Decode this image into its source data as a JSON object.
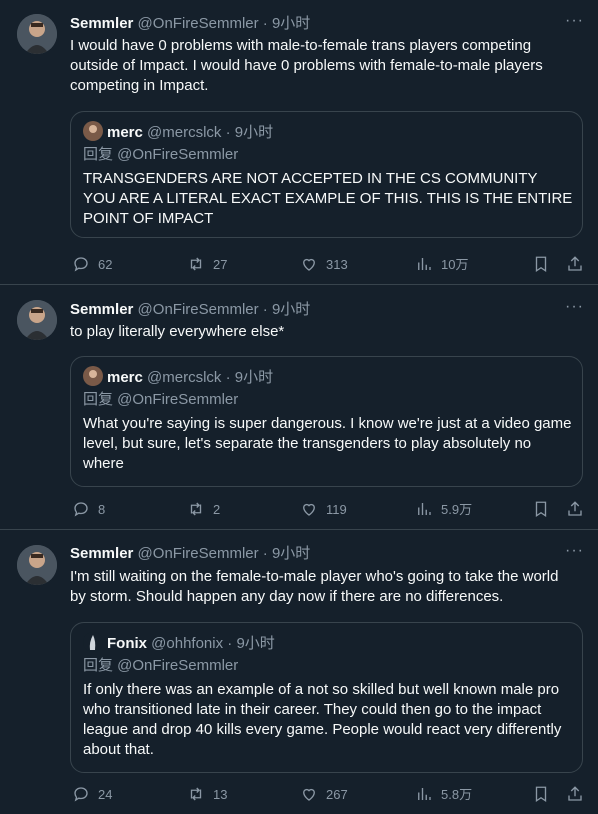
{
  "tweets": [
    {
      "name": "Semmler",
      "handle": "@OnFireSemmler",
      "time": "· 9小时",
      "more": "···",
      "text": "I would have 0 problems with male-to-female trans players competing outside of Impact. I would have 0 problems with female-to-male players competing in Impact.",
      "quote": {
        "name": "merc",
        "handle": "@mercslck",
        "time": "· 9小时",
        "reply": "回复 @OnFireSemmler",
        "text": "TRANSGENDERS ARE NOT ACCEPTED IN THE CS COMMUNITY YOU ARE A LITERAL EXACT EXAMPLE OF THIS. THIS IS THE ENTIRE POINT OF IMPACT"
      },
      "stats": {
        "replies": "62",
        "retweets": "27",
        "likes": "313",
        "views": "10万"
      }
    },
    {
      "name": "Semmler",
      "handle": "@OnFireSemmler",
      "time": "· 9小时",
      "more": "···",
      "text": "to play literally everywhere else*",
      "quote": {
        "name": "merc",
        "handle": "@mercslck",
        "time": "· 9小时",
        "reply": "回复 @OnFireSemmler",
        "text": "What you're saying is super dangerous. I know we're just at a video game level, but sure, let's separate the transgenders to play absolutely no where"
      },
      "stats": {
        "replies": "8",
        "retweets": "2",
        "likes": "119",
        "views": "5.9万"
      }
    },
    {
      "name": "Semmler",
      "handle": "@OnFireSemmler",
      "time": "· 9小时",
      "more": "···",
      "text": "I'm still waiting on the female-to-male player who's going to take the world by storm. Should happen any day now if there are no differences.",
      "quote": {
        "name": "Fonix",
        "handle": "@ohhfonix",
        "time": "· 9小时",
        "reply": "回复 @OnFireSemmler",
        "text": "If only there was an example of a not so skilled but well known male pro who transitioned late in their career. They could then go to the impact league and drop 40 kills every game. People would react very differently about that."
      },
      "stats": {
        "replies": "24",
        "retweets": "13",
        "likes": "267",
        "views": "5.8万"
      }
    }
  ],
  "colors": {
    "background": "#15202b",
    "border": "#38444d",
    "text": "#f7f9f9",
    "muted": "#8b98a5"
  },
  "icons": [
    "avatar",
    "more-icon",
    "reply-icon",
    "retweet-icon",
    "like-icon",
    "views-icon",
    "bookmark-icon",
    "share-icon"
  ]
}
